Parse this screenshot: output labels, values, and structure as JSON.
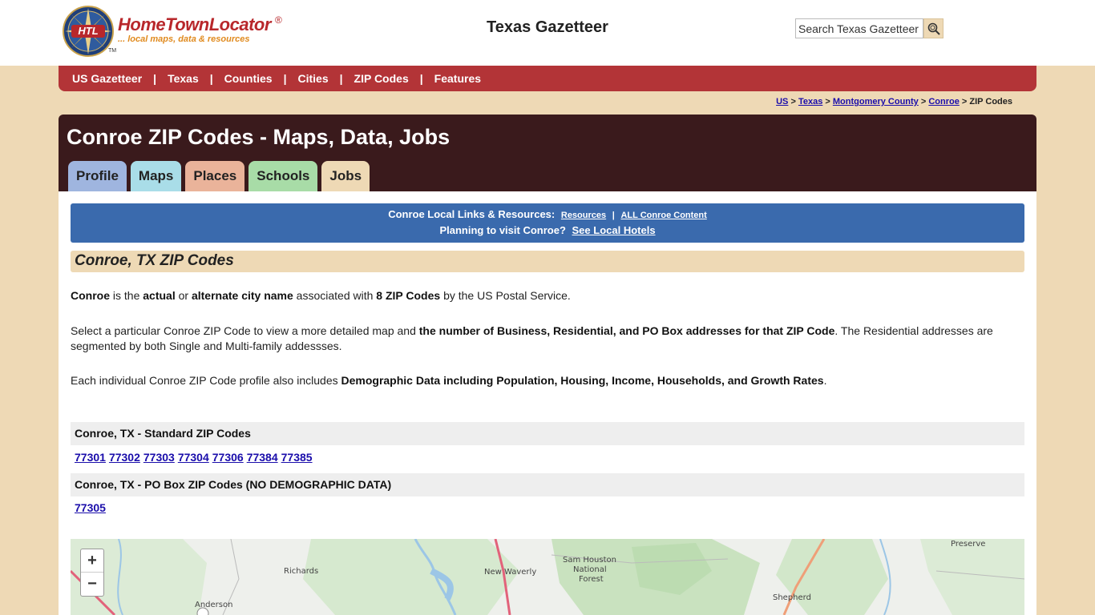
{
  "logo": {
    "word": "HomeTownLocator",
    "reg": "®",
    "tagline": "... local maps, data & resources",
    "emblem": "HTL",
    "tm": "TM"
  },
  "site_title": "Texas Gazetteer",
  "search": {
    "placeholder": "Search Texas Gazetteer",
    "icon": "search-icon"
  },
  "nav": [
    "US Gazetteer",
    "Texas",
    "Counties",
    "Cities",
    "ZIP Codes",
    "Features"
  ],
  "nav_separator": "|",
  "breadcrumb": {
    "links": [
      "US",
      "Texas",
      "Montgomery County",
      "Conroe"
    ],
    "separator": ">",
    "current": "ZIP Codes"
  },
  "page_title": "Conroe ZIP Codes - Maps, Data, Jobs",
  "tabs": [
    {
      "label": "Profile",
      "color": "#9fb5df"
    },
    {
      "label": "Maps",
      "color": "#a9dde8"
    },
    {
      "label": "Places",
      "color": "#eab39a"
    },
    {
      "label": "Schools",
      "color": "#a8dca7"
    },
    {
      "label": "Jobs",
      "color": "#eed9b5"
    }
  ],
  "promo": {
    "label": "Conroe Local Links & Resources:",
    "link1": "Resources",
    "divider": "|",
    "link2": "ALL Conroe Content",
    "visit": "Planning to visit Conroe?",
    "hotels": "See Local Hotels"
  },
  "section_title": "Conroe, TX ZIP Codes",
  "p1": {
    "city": "Conroe",
    "t1": " is the ",
    "actual": "actual",
    "t2": " or ",
    "alt": "alternate city name",
    "t3": " associated with ",
    "count": "8 ZIP Codes",
    "t4": " by the US Postal Service."
  },
  "p2": {
    "t1": "Select a particular Conroe ZIP Code to view a more detailed map and ",
    "bold": "the number of Business, Residential, and PO Box addresses for that ZIP Code",
    "t2": ". The Residential addresses are segmented by both Single and Multi-family addessses."
  },
  "p3": {
    "t1": "Each individual Conroe ZIP Code profile also includes ",
    "bold": "Demographic Data including Population, Housing, Income, Households, and Growth Rates",
    "t2": "."
  },
  "standard_heading": "Conroe, TX - Standard ZIP Codes",
  "standard_zips": [
    "77301",
    "77302",
    "77303",
    "77304",
    "77306",
    "77384",
    "77385"
  ],
  "pobox_heading": "Conroe, TX - PO Box ZIP Codes (NO DEMOGRAPHIC DATA)",
  "pobox_zips": [
    "77305"
  ],
  "map": {
    "zoom_in": "+",
    "zoom_out": "−",
    "labels": {
      "richards": "Richards",
      "anderson": "Anderson",
      "new_waverly": "New Waverly",
      "sam_houston": "Sam Houston",
      "national": "National",
      "forest": "Forest",
      "shepherd": "Shepherd",
      "preserve": "Preserve"
    }
  },
  "colors": {
    "nav_bg": "#b33437",
    "header_bg": "#3a1a1c",
    "promo_bg": "#3a6aad",
    "page_bg": "#eed9b5",
    "link": "#1a0dab"
  }
}
